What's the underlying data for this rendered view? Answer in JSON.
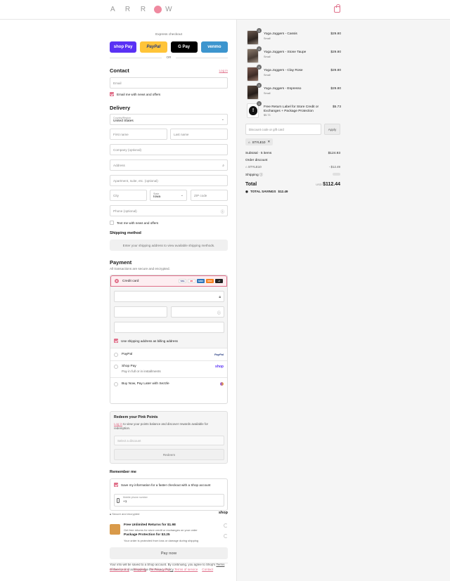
{
  "header": {
    "logo": "ARR W",
    "logo_o_color": "#ef8aa0",
    "bag_icon": "shopping-bag-icon"
  },
  "express": {
    "title": "Express checkout",
    "buttons": [
      "shop Pay",
      "PayPal",
      "G Pay",
      "venmo"
    ],
    "or": "OR"
  },
  "contact": {
    "heading": "Contact",
    "login_link": "Log in",
    "email_placeholder": "Email",
    "news_label": "Email me with news and offers"
  },
  "delivery": {
    "heading": "Delivery",
    "country_label": "Country/Region",
    "country_value": "United States",
    "first_name": "First name",
    "last_name": "Last name",
    "company": "Company (optional)",
    "address": "Address",
    "apartment": "Apartment, suite, etc. (optional)",
    "city": "City",
    "state_label": "State",
    "state_value": "Iowa",
    "zip": "ZIP code",
    "phone": "Phone (optional)",
    "text_label": "Text me with news and offers"
  },
  "shipping": {
    "heading": "Shipping method",
    "notice": "Enter your shipping address to view available shipping methods."
  },
  "payment": {
    "heading": "Payment",
    "sub": "All transactions are secure and encrypted.",
    "credit_card": "Credit card",
    "card_brands": [
      "VISA",
      "MC",
      "AMEX",
      "DISC",
      "+4"
    ],
    "billing_label": "Use shipping address as billing address",
    "paypal": "PayPal",
    "paypal_logo": "PayPal",
    "shop_pay": "Shop Pay",
    "shop_pay_sub": "Pay in full or in installments",
    "shop_logo": "shop",
    "sezzle": "Buy Now, Pay Later with Sezzle"
  },
  "points": {
    "heading": "Redeem your Pink Points",
    "login": "Log in",
    "text": " to view your points balance and discover rewards available for redemption.",
    "select": "Select a discount",
    "button": "Redeem"
  },
  "remember": {
    "heading": "Remember me",
    "save_label": "Save my information for a faster checkout with a Shop account",
    "phone_label": "Mobile phone number",
    "phone_value": "+1",
    "secure": "Secure and encrypted",
    "shop_logo": "shop"
  },
  "upsell": {
    "returns_title": "Free Unlimited Returns for $1.98",
    "returns_sub": "Get free returns for store credit or exchanges on your order",
    "protect_title": "Package Protection for $3.25",
    "protect_sub": "Your order is protected from loss or damage during shipping"
  },
  "pay_now": "Pay now",
  "legal": {
    "text1": "Your info will be saved to a Shop account. By continuing, you agree to Shop's ",
    "tos": "Terms of Service",
    "text2": " and acknowledge the ",
    "privacy": "Privacy Policy",
    "text3": "."
  },
  "footer_links": [
    "Refund policy",
    "Shipping",
    "Privacy policy",
    "Terms of service",
    "Contact"
  ],
  "cart": {
    "items": [
      {
        "qty": "1",
        "name": "Yoga Joggers - Cassis",
        "variant": "Small",
        "price": "$29.80"
      },
      {
        "qty": "1",
        "name": "Yoga Joggers - Stone Taupe",
        "variant": "Small",
        "price": "$29.80"
      },
      {
        "qty": "1",
        "name": "Yoga Joggers - Clay Rose",
        "variant": "Small",
        "price": "$29.80"
      },
      {
        "qty": "1",
        "name": "Yoga Joggers - Espresso",
        "variant": "Small",
        "price": "$29.80"
      },
      {
        "qty": "1",
        "name": "Free Return Label for Store Credit or Exchanges + Package Protection",
        "variant": "$5.73",
        "price": "$5.73"
      }
    ],
    "discount_placeholder": "Discount code or gift card",
    "apply": "Apply",
    "code": "STYLE10",
    "subtotal_label": "Subtotal · 5 items",
    "subtotal": "$124.93",
    "order_discount": "Order discount",
    "discount_code": "STYLE10",
    "discount_value": "- $12.49",
    "shipping_label": "Shipping",
    "total_label": "Total",
    "currency": "USD",
    "total": "$112.44",
    "savings_label": "TOTAL SAVINGS",
    "savings": "$12.49"
  }
}
